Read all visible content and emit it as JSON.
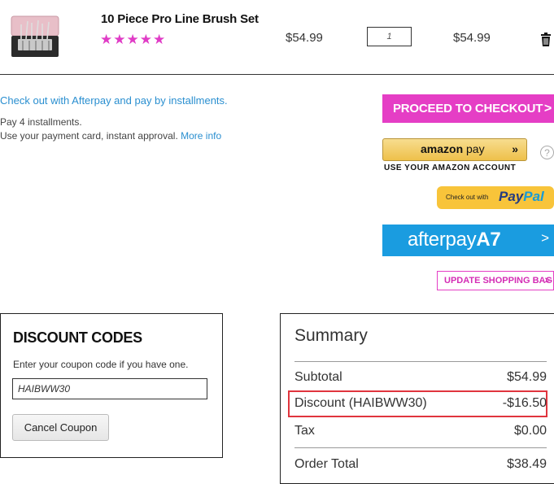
{
  "product": {
    "name": "10 Piece Pro Line Brush Set",
    "stars": "★★★★★",
    "price": "$54.99",
    "quantity": "1",
    "total": "$54.99"
  },
  "afterpay_info": {
    "heading": "Check out with Afterpay and pay by installments.",
    "line1": "Pay 4 installments.",
    "line2": "Use your payment card, instant approval.",
    "more_info": "More info"
  },
  "checkout": {
    "proceed_label": "PROCEED TO CHECKOUT",
    "amazon_logo_amazon": "amazon",
    "amazon_logo_pay": " pay",
    "amazon_arrow": "»",
    "amazon_sub": "USE YOUR AMAZON ACCOUNT",
    "help": "?",
    "paypal_small": "Check out with",
    "paypal_pay": "Pay",
    "paypal_pal": "Pal",
    "afterpay_logo_a": "afterpay",
    "afterpay_logo_b": "A7",
    "update_bag": "UPDATE SHOPPING BAG"
  },
  "discount": {
    "title": "DISCOUNT CODES",
    "label": "Enter your coupon code if you have one.",
    "code": "HAIBWW30",
    "cancel": "Cancel Coupon"
  },
  "summary": {
    "title": "Summary",
    "subtotal_label": "Subtotal",
    "subtotal": "$54.99",
    "discount_label": "Discount (HAIBWW30)",
    "discount": "-$16.50",
    "tax_label": "Tax",
    "tax": "$0.00",
    "total_label": "Order Total",
    "total": "$38.49"
  },
  "colors": {
    "accent_pink": "#e53ec5",
    "afterpay_blue": "#1a9ce0",
    "highlight_red": "#e0353e"
  }
}
